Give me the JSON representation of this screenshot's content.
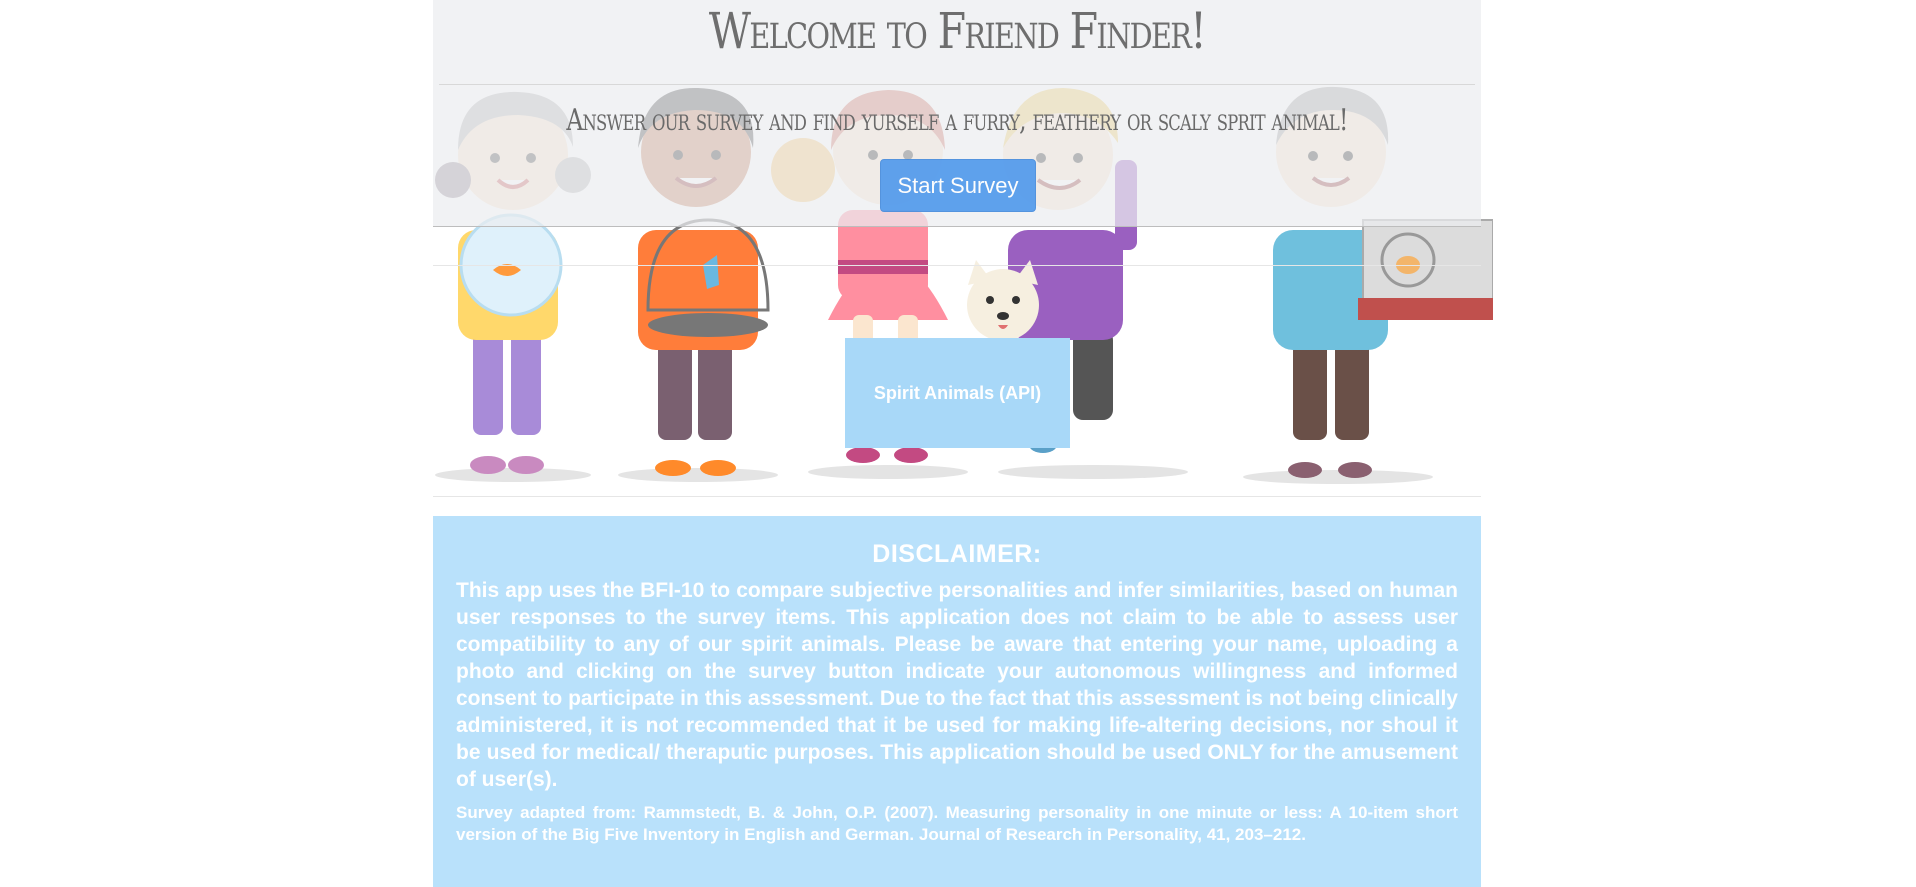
{
  "jumbotron": {
    "title": "Welcome to Friend Finder!",
    "subtitle": "Answer our survey and find yurself a furry, feathery or scaly sprit animal!",
    "start_button": "Start Survey"
  },
  "api_button": {
    "label": "Spirit Animals (API)"
  },
  "disclaimer": {
    "heading": "DISCLAIMER:",
    "body": "This app uses the BFI-10 to compare subjective personalities and infer similarities, based on human user responses to the survey items. This application does not claim to be able to assess user compatibility to any of our spirit animals. Please be aware that entering your name, uploading a photo and clicking on the survey button indicate your autonomous willingness and informed consent to participate in this assessment. Due to the fact that this assessment is not being clinically administered, it is not recommended that it be used for making life-altering decisions, nor shoul it be used for medical/ theraputic purposes. This application should be used ONLY for the amusement of user(s).",
    "citation": "Survey adapted from: Rammstedt, B. & John, O.P. (2007). Measuring personality in one minute or less: A 10-item short version of the Big Five Inventory in English and German. Journal of Research in Personality, 41, 203–212."
  },
  "colors": {
    "jumbotron_bg": "#eceef0",
    "button_primary": "#4a96ec",
    "api_button_bg": "#a8d8f8",
    "disclaimer_bg": "#b9e1fb",
    "text_white": "#ffffff"
  },
  "illustration": {
    "description_icon": "kids-with-pets-illustration",
    "pets": [
      "goldfish-bowl-icon",
      "bird-cage-icon",
      "cat-icon",
      "dog-icon",
      "hamster-cage-icon"
    ]
  }
}
